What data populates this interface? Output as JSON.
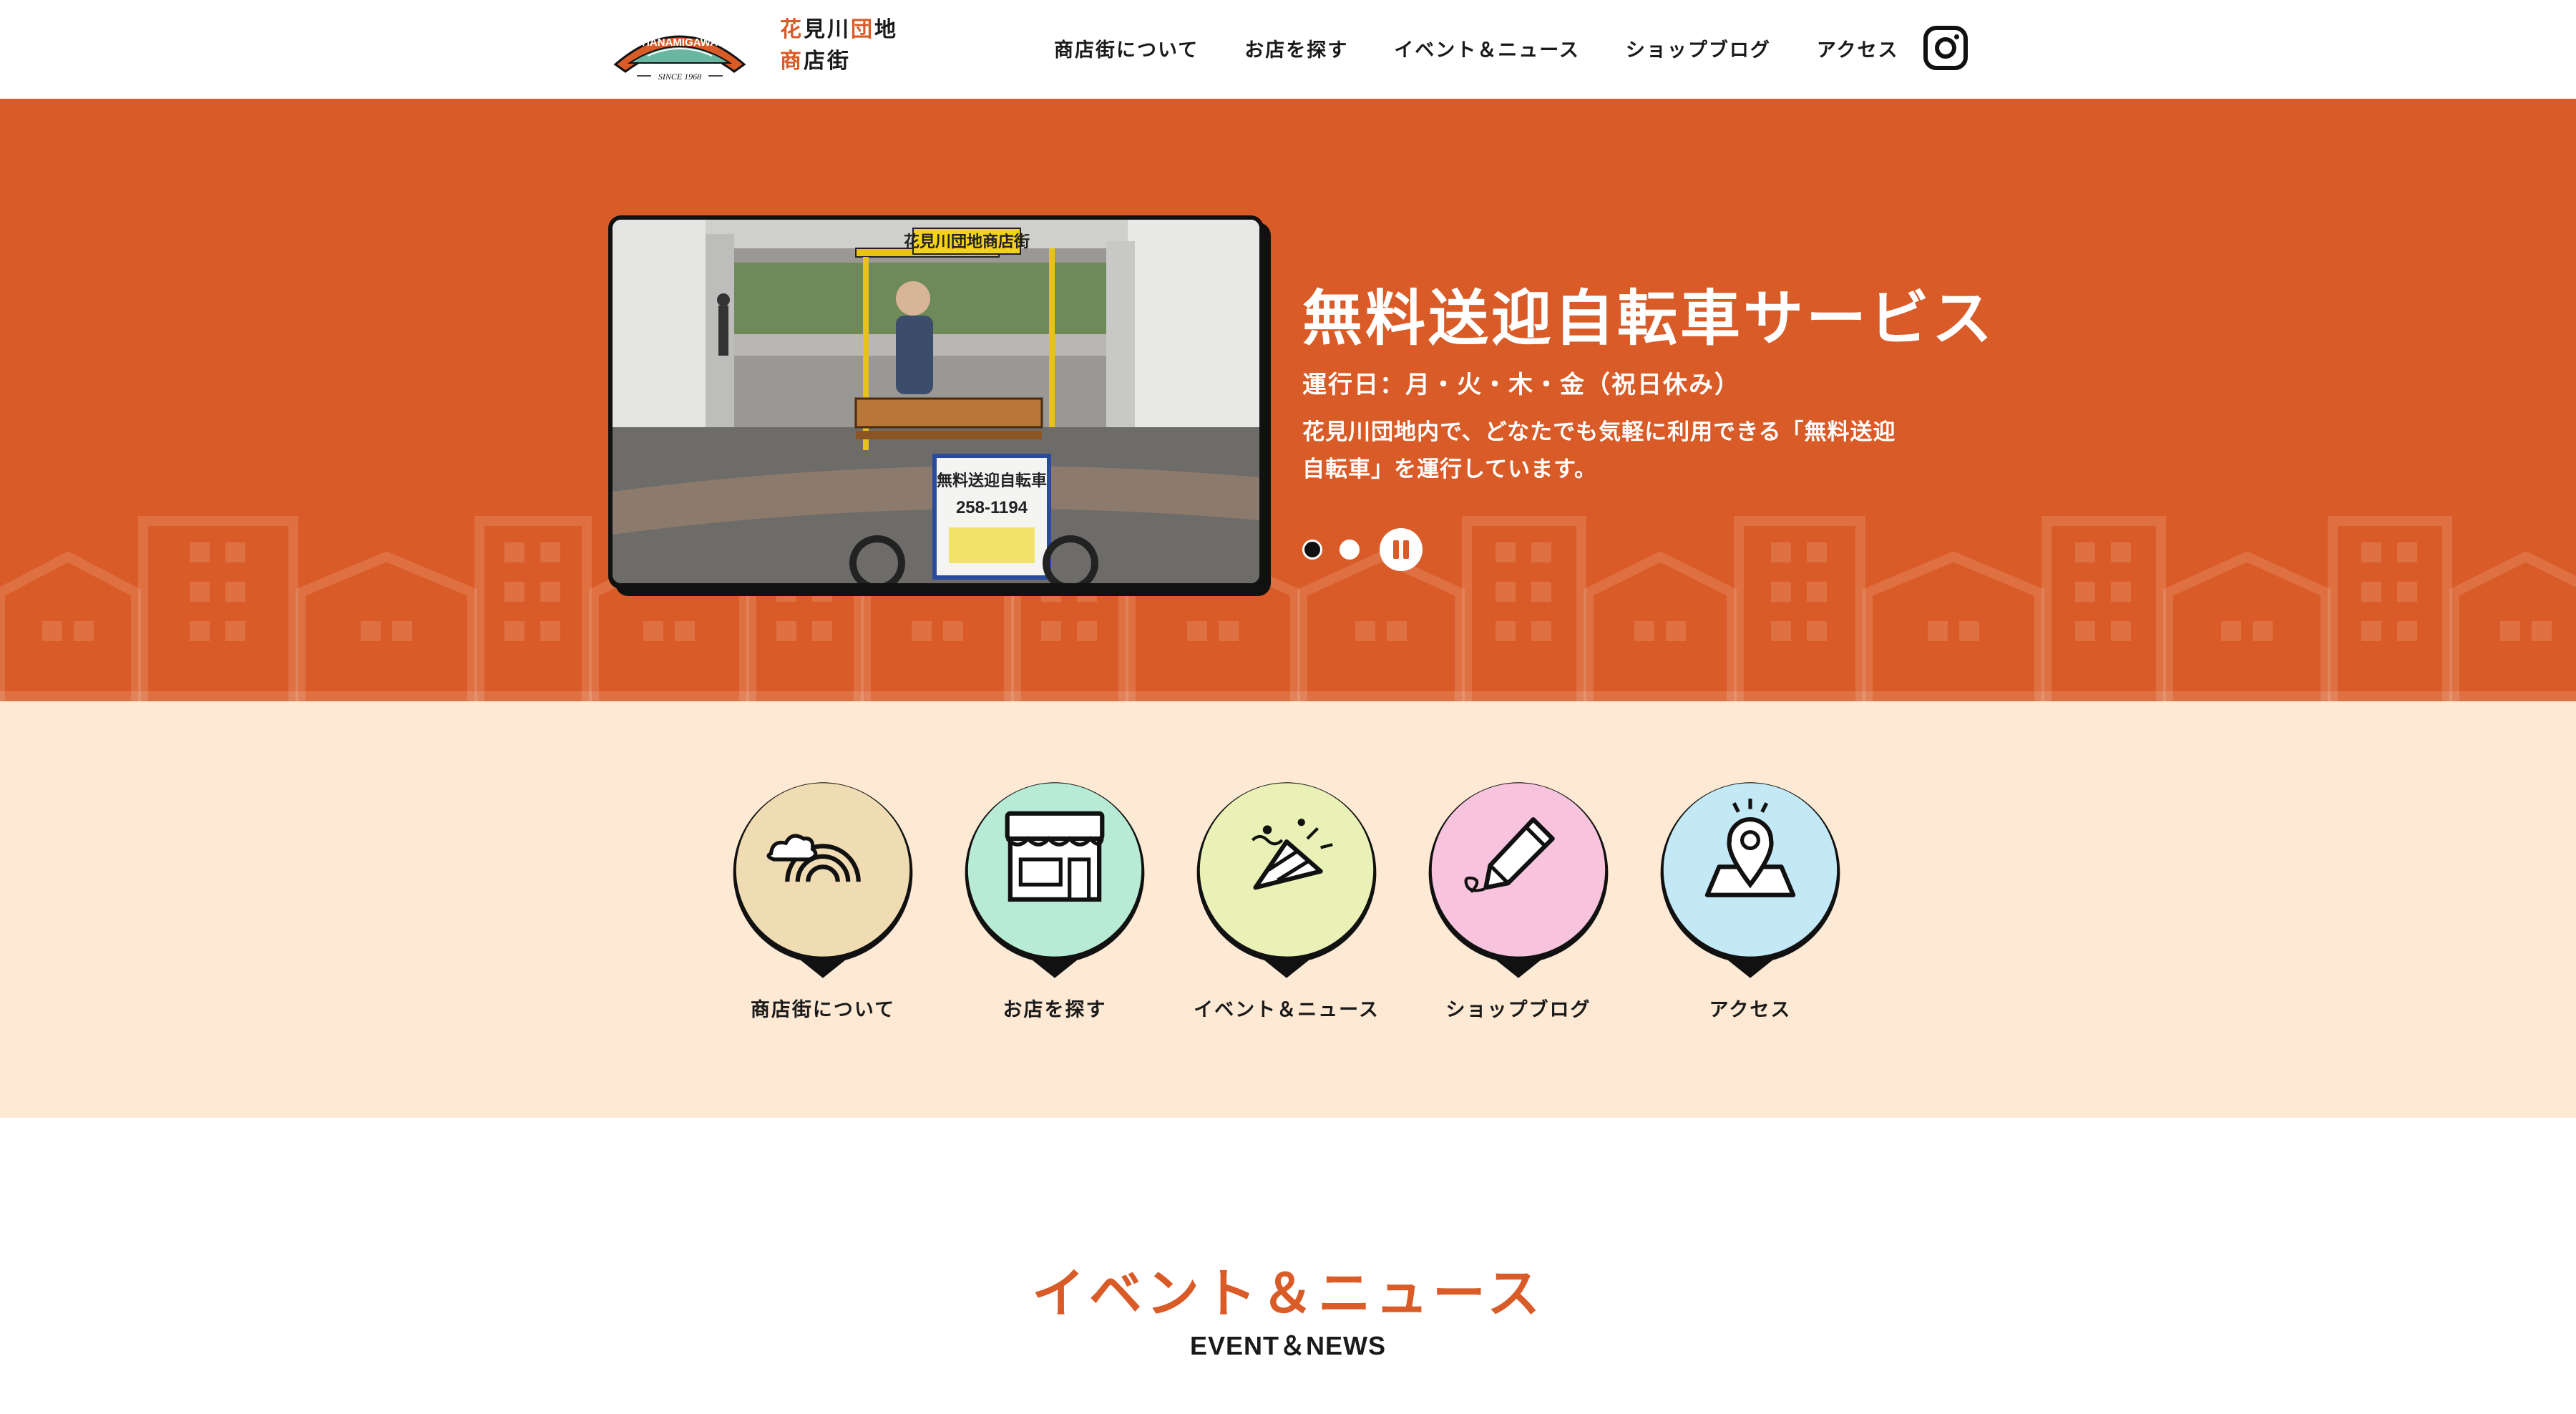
{
  "header": {
    "brand": {
      "line1": [
        {
          "char": "花",
          "accent": true
        },
        {
          "char": "見",
          "accent": false
        },
        {
          "char": "川",
          "accent": false
        },
        {
          "char": "団",
          "accent": true
        },
        {
          "char": "地",
          "accent": false
        }
      ],
      "line2": [
        {
          "char": "商",
          "accent": true
        },
        {
          "char": "店",
          "accent": false
        },
        {
          "char": "街",
          "accent": false
        }
      ]
    },
    "logo_text": {
      "top": "HANAMIGAWA",
      "bottom": "SINCE 1968"
    },
    "nav": [
      "商店街について",
      "お店を探す",
      "イベント＆ニュース",
      "ショップブログ",
      "アクセス"
    ],
    "social_icon": "instagram-icon"
  },
  "hero": {
    "title": "無料送迎自転車サービス",
    "subtitle": "運行日：月・火・木・金（祝日休み）",
    "description": "花見川団地内で、どなたでも気軽に利用できる「無料送迎自転車」を運行しています。",
    "photo_sign_top": "花見川団地商店街",
    "photo_sign_board": "無料送迎自転車",
    "photo_sign_phone": "258-1194",
    "slider": {
      "slide_count": 2,
      "active_index": 0,
      "control_icon": "pause-icon"
    }
  },
  "categories": [
    {
      "label": "商店街について",
      "icon": "rainbow-icon",
      "color": "#efdcb2"
    },
    {
      "label": "お店を探す",
      "icon": "storefront-icon",
      "color": "#b8ebd6"
    },
    {
      "label": "イベント＆ニュース",
      "icon": "party-popper-icon",
      "color": "#eaf1b6"
    },
    {
      "label": "ショップブログ",
      "icon": "pencil-icon",
      "color": "#f7c3dd"
    },
    {
      "label": "アクセス",
      "icon": "map-pin-icon",
      "color": "#c3e9f6"
    }
  ],
  "section": {
    "title": "イベント＆ニュース",
    "subtitle": "EVENT＆NEWS"
  },
  "colors": {
    "accent": "#d95b27",
    "cream": "#fde9d4",
    "ink": "#111111"
  }
}
